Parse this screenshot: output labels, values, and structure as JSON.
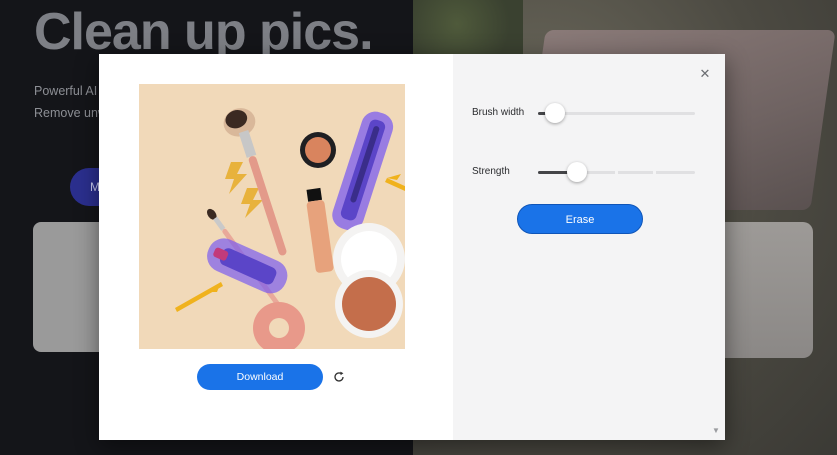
{
  "background": {
    "hero_title": "Clean up pics.",
    "subtext_line1": "Powerful AI",
    "subtext_line2": "Remove unw",
    "cta_label": "M"
  },
  "modal": {
    "close_icon": "close-icon",
    "download_label": "Download",
    "reset_icon": "refresh-icon",
    "brush_width": {
      "label": "Brush width",
      "value": 0.06
    },
    "strength": {
      "label": "Strength",
      "value": 0.25
    },
    "erase_label": "Erase"
  },
  "colors": {
    "primary_button": "#1a73e8",
    "mask_highlight": "#7b5cf0",
    "arrow": "#f0b21d",
    "image_background": "#f1d9b9"
  }
}
